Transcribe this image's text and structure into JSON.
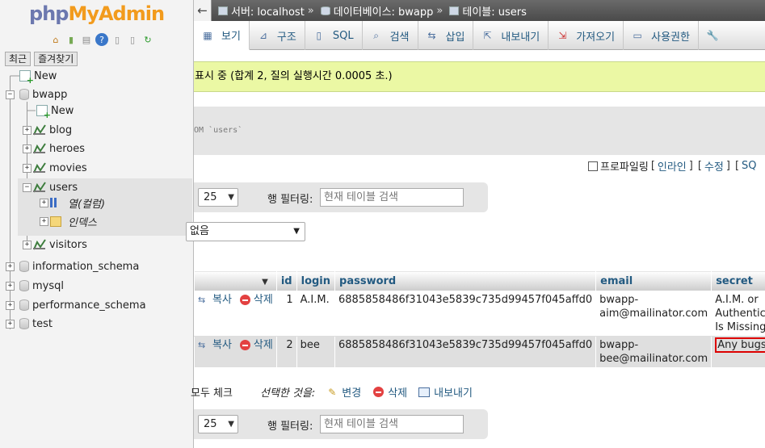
{
  "nav": {
    "logo_php": "php",
    "logo_admin": "MyAdmin",
    "tabs": [
      "최근",
      "즐겨찾기"
    ],
    "tree": {
      "new": "New",
      "db_bwapp": "bwapp",
      "bwapp_new": "New",
      "tables": [
        "blog",
        "heroes",
        "movies",
        "users",
        "visitors"
      ],
      "users_children": [
        "열(컬럼)",
        "인덱스"
      ],
      "databases": [
        "information_schema",
        "mysql",
        "performance_schema",
        "test"
      ]
    }
  },
  "breadcrumb": {
    "server": "서버: localhost",
    "database": "데이터베이스: bwapp",
    "table": "테이블: users",
    "sep": "»"
  },
  "tabs": [
    "보기",
    "구조",
    "SQL",
    "검색",
    "삽입",
    "내보내기",
    "가져오기",
    "사용권한"
  ],
  "success_message": "표시 중 (합계 2, 질의 실행시간 0.0005 초.)",
  "sql_fragment": "OM `users`",
  "profiling": {
    "label": "프로파일링",
    "links": [
      "인라인",
      "수정",
      "SQ"
    ]
  },
  "navbar": {
    "rows_value": "25",
    "filter_label": "행 필터링:",
    "filter_placeholder": "현재 테이블 검색"
  },
  "sort_select": "없음",
  "table": {
    "columns": [
      "id",
      "login",
      "password",
      "email",
      "secret"
    ],
    "actions": {
      "copy": "복사",
      "delete": "삭제"
    },
    "rows": [
      {
        "id": "1",
        "login": "A.I.M.",
        "password": "6885858486f31043e5839c735d99457f045affd0",
        "email_1": "bwapp-",
        "email_2": "aim@mailinator.com",
        "secret_lines": [
          "A.I.M. or",
          "Authentication",
          "Is Missing"
        ]
      },
      {
        "id": "2",
        "login": "bee",
        "password": "6885858486f31043e5839c735d99457f045affd0",
        "email_1": "bwapp-",
        "email_2": "bee@mailinator.com",
        "secret_lines": [
          "Any bugs?"
        ]
      }
    ]
  },
  "bulk": {
    "check_all": "모두 체크",
    "with_selected": "선택한 것을:",
    "edit": "변경",
    "delete": "삭제",
    "export": "내보내기"
  },
  "colors": {
    "accent": "#235a81",
    "success_bg": "#ebf8a4",
    "highlight_border": "#dd0000"
  }
}
